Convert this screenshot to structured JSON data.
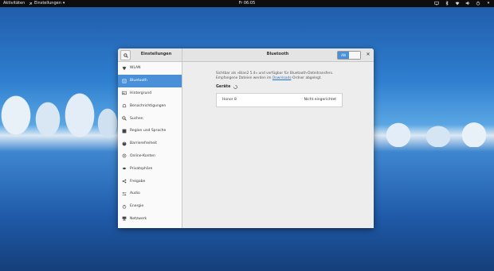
{
  "topbar": {
    "activities": "Aktivitäten",
    "app_menu": "Einstellungen",
    "clock": "Fr 06:05"
  },
  "window": {
    "sidebar_title": "Einstellungen",
    "panel_title": "Bluetooth",
    "toggle_label": "AN"
  },
  "sidebar": {
    "items": [
      {
        "label": "WLAN",
        "icon": "wifi-icon"
      },
      {
        "label": "Bluetooth",
        "icon": "bluetooth-icon"
      },
      {
        "label": "Hintergrund",
        "icon": "background-icon"
      },
      {
        "label": "Benachrichtigungen",
        "icon": "notifications-icon"
      },
      {
        "label": "Suchen",
        "icon": "search-icon"
      },
      {
        "label": "Region und Sprache",
        "icon": "region-icon"
      },
      {
        "label": "Barrierefreiheit",
        "icon": "accessibility-icon"
      },
      {
        "label": "Online-Konten",
        "icon": "online-accounts-icon"
      },
      {
        "label": "Privatsphäre",
        "icon": "privacy-icon"
      },
      {
        "label": "Freigabe",
        "icon": "sharing-icon"
      },
      {
        "label": "Audio",
        "icon": "audio-icon"
      },
      {
        "label": "Energie",
        "icon": "power-icon"
      },
      {
        "label": "Netzwerk",
        "icon": "network-icon"
      }
    ]
  },
  "bluetooth": {
    "desc_line1": "Sichtbar als »Bian2 5.4« und verfügbar für Bluetooth-Dateitransfers.",
    "desc_line2_pre": "Empfangene Dateien werden im ",
    "desc_link": "Downloads",
    "desc_line2_post": "-Ordner abgelegt.",
    "devices_heading": "Geräte",
    "devices": [
      {
        "name": "Honor 8",
        "status": "Nicht eingerichtet"
      }
    ]
  },
  "colors": {
    "accent": "#4a90d9",
    "topbar": "#0e0e0e"
  }
}
